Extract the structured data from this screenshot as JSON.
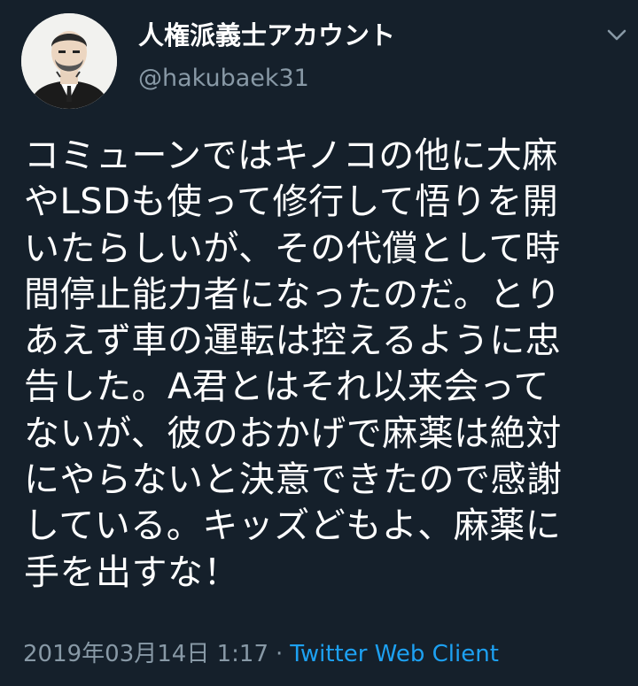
{
  "user": {
    "display_name": "人権派義士アカウント",
    "handle": "@hakubaek31"
  },
  "icons": {
    "menu": "chevron-down-icon",
    "avatar": "avatar-illustration"
  },
  "tweet": {
    "lines": [
      "コミューンではキノコの他に大麻",
      "やLSDも使って修行して悟りを開",
      "いたらしいが、その代償として時",
      "間停止能力者になったのだ。とり",
      "あえず車の運転は控えるように忠",
      "告した。A君とはそれ以来会って",
      "ないが、彼のおかげで麻薬は絶対",
      "にやらないと決意できたので感謝",
      "している。キッズどもよ、麻薬に",
      "手を出すな！"
    ],
    "timestamp": "2019年03月14日 1:17",
    "separator": "·",
    "source": "Twitter Web Client"
  },
  "colors": {
    "background": "#15202b",
    "text": "#ffffff",
    "secondary": "#8899a6",
    "link": "#1da1f2"
  }
}
